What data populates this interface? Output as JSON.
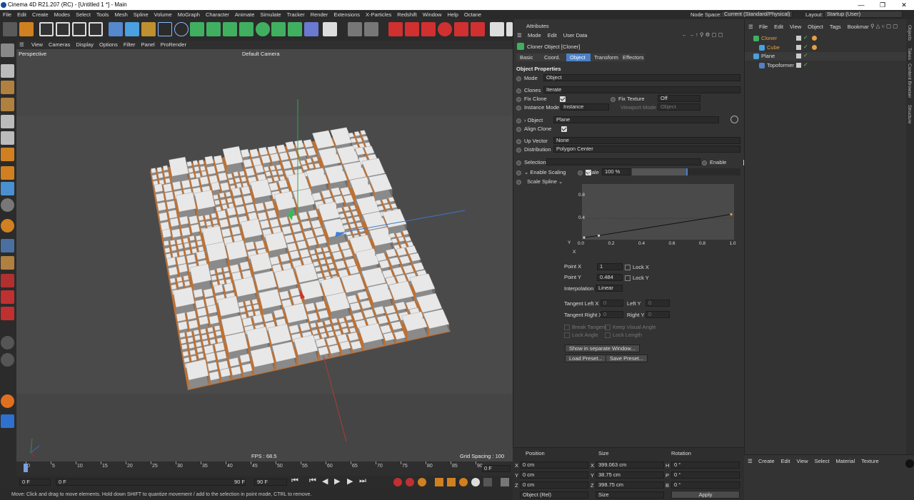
{
  "window": {
    "title": "Cinema 4D R21.207 (RC) - [Untitled 1 *] - Main"
  },
  "menubar": {
    "items": [
      "File",
      "Edit",
      "Create",
      "Modes",
      "Select",
      "Tools",
      "Mesh",
      "Spline",
      "Volume",
      "MoGraph",
      "Character",
      "Animate",
      "Simulate",
      "Tracker",
      "Render",
      "Extensions",
      "X-Particles",
      "Redshift",
      "Window",
      "Help",
      "Octane"
    ],
    "node_space_label": "Node Space:",
    "node_space_value": "Current (Standard/Physical)",
    "layout_label": "Layout:",
    "layout_value": "Startup (User)"
  },
  "viewport": {
    "menu": [
      "View",
      "Cameras",
      "Display",
      "Options",
      "Filter",
      "Panel",
      "ProRender"
    ],
    "name": "Perspective",
    "camera": "Default Camera",
    "fps": "FPS : 68.5",
    "grid_spacing": "Grid Spacing : 100 cm"
  },
  "timeline": {
    "ticks": [
      "0",
      "5",
      "10",
      "15",
      "20",
      "25",
      "30",
      "35",
      "40",
      "45",
      "50",
      "55",
      "60",
      "65",
      "70",
      "75",
      "80",
      "85",
      "90"
    ],
    "frame_right": "0 F"
  },
  "transport": {
    "start": "0 F",
    "current": "0 F",
    "end": "90 F",
    "end2": "90 F"
  },
  "status": "Move: Click and drag to move elements. Hold down SHIFT to quantize movement / add to the selection in point mode, CTRL to remove.",
  "attributes": {
    "panel_title": "Attributes",
    "menu": [
      "Mode",
      "Edit",
      "User Data"
    ],
    "object_title": "Cloner Object [Cloner]",
    "tabs": [
      "Basic",
      "Coord.",
      "Object",
      "Transform",
      "Effectors"
    ],
    "active_tab": "Object",
    "section": "Object Properties",
    "mode_label": "Mode",
    "mode_value": "Object",
    "clones_label": "Clones",
    "clones_value": "Iterate",
    "fix_clone_label": "Fix Clone",
    "fix_texture_label": "Fix Texture",
    "fix_texture_value": "Off",
    "instance_mode_label": "Instance Mode",
    "instance_mode_value": "Instance",
    "viewport_mode_label": "Viewport Mode",
    "viewport_mode_value": "Object",
    "object_label": "Object",
    "object_value": "Plane",
    "align_clone_label": "Align Clone",
    "up_vector_label": "Up Vector",
    "up_vector_value": "None",
    "distribution_label": "Distribution",
    "distribution_value": "Polygon Center",
    "selection_label": "Selection",
    "enable_label": "Enable",
    "enable_scaling_label": "Enable Scaling",
    "scale_label": "Scale",
    "scale_value": "100 %",
    "scale_spline_label": "Scale Spline",
    "spline_y_ticks": [
      "0.8",
      "0.4"
    ],
    "spline_x_ticks": [
      "0.0",
      "0.2",
      "0.4",
      "0.6",
      "0.8",
      "1.0"
    ],
    "spline_y_axis": "Y",
    "spline_x_axis": "X",
    "point_x_label": "Point X",
    "point_x_value": "1",
    "lock_x_label": "Lock X",
    "point_y_label": "Point Y",
    "point_y_value": "0.484",
    "lock_y_label": "Lock Y",
    "interpolation_label": "Interpolation",
    "interpolation_value": "Linear",
    "tangent_left_x_label": "Tangent Left X",
    "tangent_left_x_value": "0",
    "left_y_label": "Left Y",
    "left_y_value": "0",
    "tangent_right_x_label": "Tangent Right X",
    "tangent_right_x_value": "0",
    "right_y_label": "Right Y",
    "right_y_value": "0",
    "break_tangent_label": "Break Tangent",
    "keep_visual_angle_label": "Keep Visual Angle",
    "lock_angle_label": "Lock Angle",
    "lock_length_label": "Lock Length",
    "show_window_button": "Show in separate Window...",
    "load_preset_button": "Load Preset...",
    "save_preset_button": "Save Preset..."
  },
  "coordinates": {
    "headers": [
      "Position",
      "Size",
      "Rotation"
    ],
    "rows": [
      {
        "axis": "X",
        "pos": "0 cm",
        "size_axis": "X",
        "size": "399.063 cm",
        "rot_axis": "H",
        "rot": "0 °"
      },
      {
        "axis": "Y",
        "pos": "0 cm",
        "size_axis": "Y",
        "size": "38.75 cm",
        "rot_axis": "P",
        "rot": "0 °"
      },
      {
        "axis": "Z",
        "pos": "0 cm",
        "size_axis": "Z",
        "size": "398.75 cm",
        "rot_axis": "B",
        "rot": "0 °"
      }
    ],
    "dropdown1": "Object (Rel)",
    "dropdown2": "Size",
    "apply_button": "Apply"
  },
  "objects": {
    "menu": [
      "File",
      "Edit",
      "View",
      "Object",
      "Tags",
      "Bookmar"
    ],
    "items": [
      {
        "name": "Cloner",
        "indent": 0
      },
      {
        "name": "Cube",
        "indent": 1
      },
      {
        "name": "Plane",
        "indent": 0
      },
      {
        "name": "Topoformer",
        "indent": 1
      }
    ],
    "side_tabs": [
      "Objects",
      "Takes",
      "Content Browser",
      "Structure"
    ]
  },
  "materials": {
    "menu": [
      "Create",
      "Edit",
      "View",
      "Select",
      "Material",
      "Texture"
    ]
  },
  "colors": {
    "accent": "#4a80c8",
    "bg": "#333333",
    "viewport": "#4a4a4a",
    "orange": "#e8a040"
  }
}
